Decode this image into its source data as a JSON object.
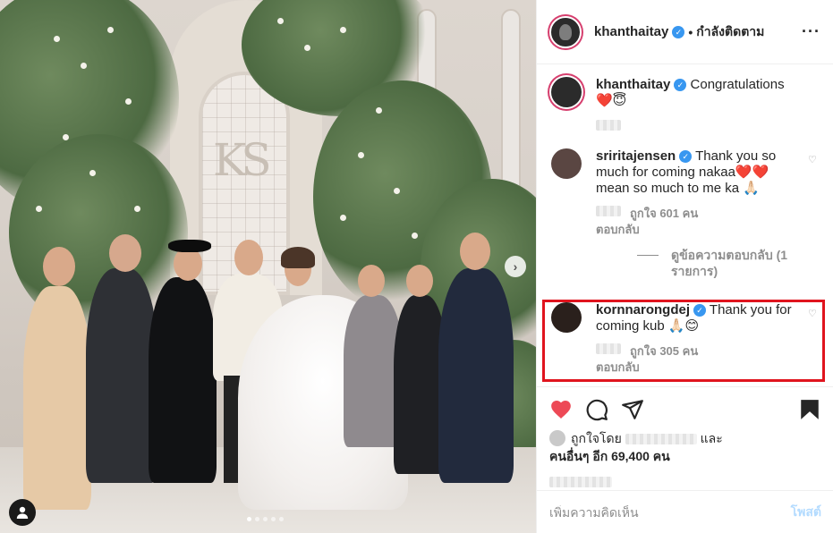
{
  "post": {
    "author": "khanthaitay",
    "follow_status": "กำลังติดตาม",
    "more_icon": "more-horizontal-icon"
  },
  "caption": {
    "username": "khanthaitay",
    "text": "Congratulations",
    "emoji": "❤️😇"
  },
  "comments": [
    {
      "username": "sriritajensen",
      "text": "Thank you so much for coming nakaa❤️❤️ mean so much to me ka 🙏🏻",
      "likes": "ถูกใจ 601 คน",
      "reply_label": "ตอบกลับ",
      "view_replies": "ดูข้อความตอบกลับ (1 รายการ)"
    },
    {
      "username": "kornnarongdej",
      "text": "Thank you for coming kub 🙏🏻😊",
      "likes": "ถูกใจ 305 คน",
      "reply_label": "ตอบกลับ"
    }
  ],
  "likes_summary": {
    "prefix": "ถูกใจโดย",
    "and": "และ",
    "others": "คนอื่นๆ อีก 69,400 คน"
  },
  "add_comment": {
    "placeholder": "เพิ่มความคิดเห็น",
    "post_label": "โพสต์"
  },
  "carousel": {
    "current": 1,
    "total": 5
  },
  "colors": {
    "verified": "#3897f0",
    "like_red": "#ed4956",
    "highlight": "#e0141e",
    "post_disabled": "#b3dbff"
  }
}
